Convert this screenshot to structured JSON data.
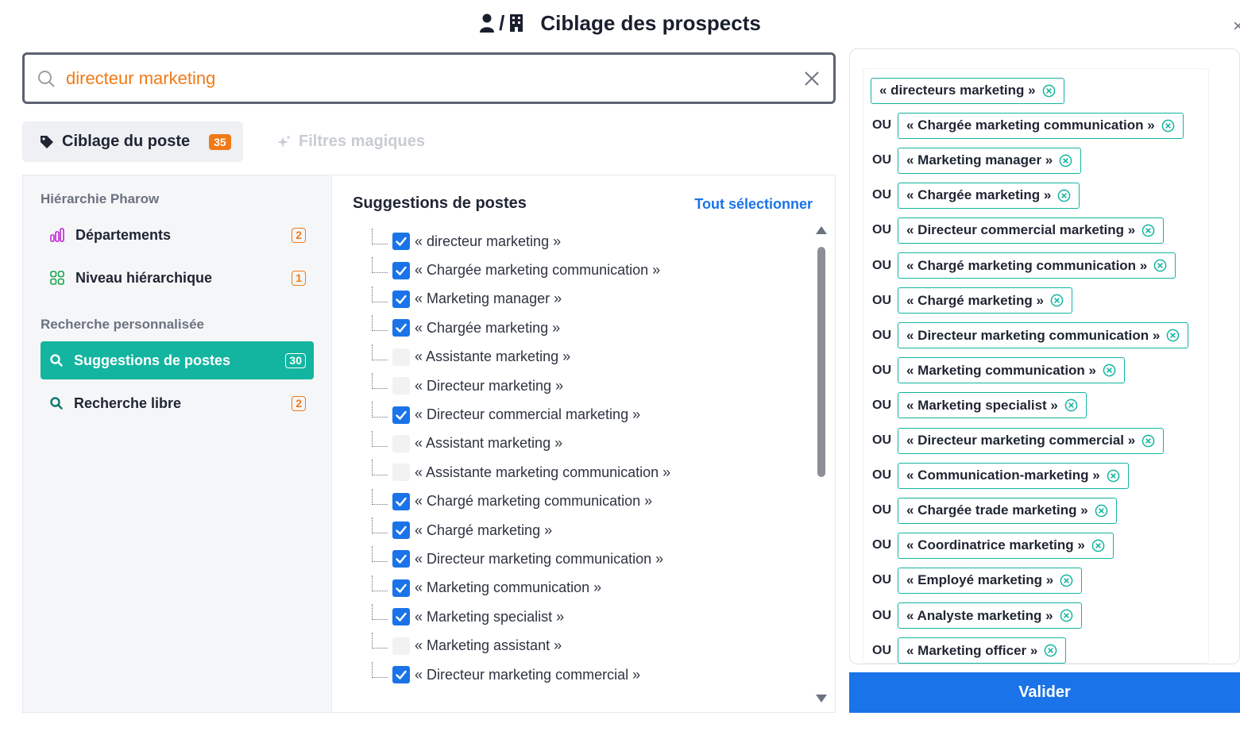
{
  "header": {
    "title": "Ciblage des prospects",
    "separator": "/"
  },
  "search": {
    "value": "directeur marketing"
  },
  "tabs": {
    "ciblage_label": "Ciblage du poste",
    "ciblage_count": "35",
    "magic_label": "Filtres magiques"
  },
  "sidebar": {
    "hierarchy_heading": "Hiérarchie Pharow",
    "departements_label": "Départements",
    "departements_count": "2",
    "niveau_label": "Niveau hiérarchique",
    "niveau_count": "1",
    "custom_heading": "Recherche personnalisée",
    "suggestions_label": "Suggestions de postes",
    "suggestions_count": "30",
    "libre_label": "Recherche libre",
    "libre_count": "2"
  },
  "suggestions": {
    "title": "Suggestions de postes",
    "select_all": "Tout sélectionner",
    "items": [
      {
        "label": "« directeur marketing »",
        "checked": true
      },
      {
        "label": "« Chargée marketing communication »",
        "checked": true
      },
      {
        "label": "« Marketing manager »",
        "checked": true
      },
      {
        "label": "« Chargée marketing »",
        "checked": true
      },
      {
        "label": "« Assistante marketing »",
        "checked": false
      },
      {
        "label": "« Directeur marketing »",
        "checked": false
      },
      {
        "label": "« Directeur commercial marketing »",
        "checked": true
      },
      {
        "label": "« Assistant marketing »",
        "checked": false
      },
      {
        "label": "« Assistante marketing communication »",
        "checked": false
      },
      {
        "label": "« Chargé marketing communication »",
        "checked": true
      },
      {
        "label": "« Chargé marketing »",
        "checked": true
      },
      {
        "label": "« Directeur marketing communication »",
        "checked": true
      },
      {
        "label": "« Marketing communication »",
        "checked": true
      },
      {
        "label": "« Marketing specialist »",
        "checked": true
      },
      {
        "label": "« Marketing assistant »",
        "checked": false
      },
      {
        "label": "« Directeur marketing commercial »",
        "checked": true
      }
    ]
  },
  "selected": {
    "connector": "OU",
    "chips": [
      "« directeurs marketing »",
      "« Chargée marketing communication »",
      "« Marketing manager »",
      "« Chargée marketing »",
      "« Directeur commercial marketing »",
      "« Chargé marketing communication »",
      "« Chargé marketing »",
      "« Directeur marketing communication »",
      "« Marketing communication »",
      "« Marketing specialist »",
      "« Directeur marketing commercial »",
      "« Communication-marketing »",
      "« Chargée trade marketing »",
      "« Coordinatrice marketing »",
      "« Employé marketing »",
      "« Analyste marketing »",
      "« Marketing officer »"
    ]
  },
  "footer": {
    "validate_label": "Valider"
  },
  "colors": {
    "accent_teal": "#13b5a0",
    "accent_blue": "#1a73e8",
    "accent_orange": "#f07a16"
  }
}
